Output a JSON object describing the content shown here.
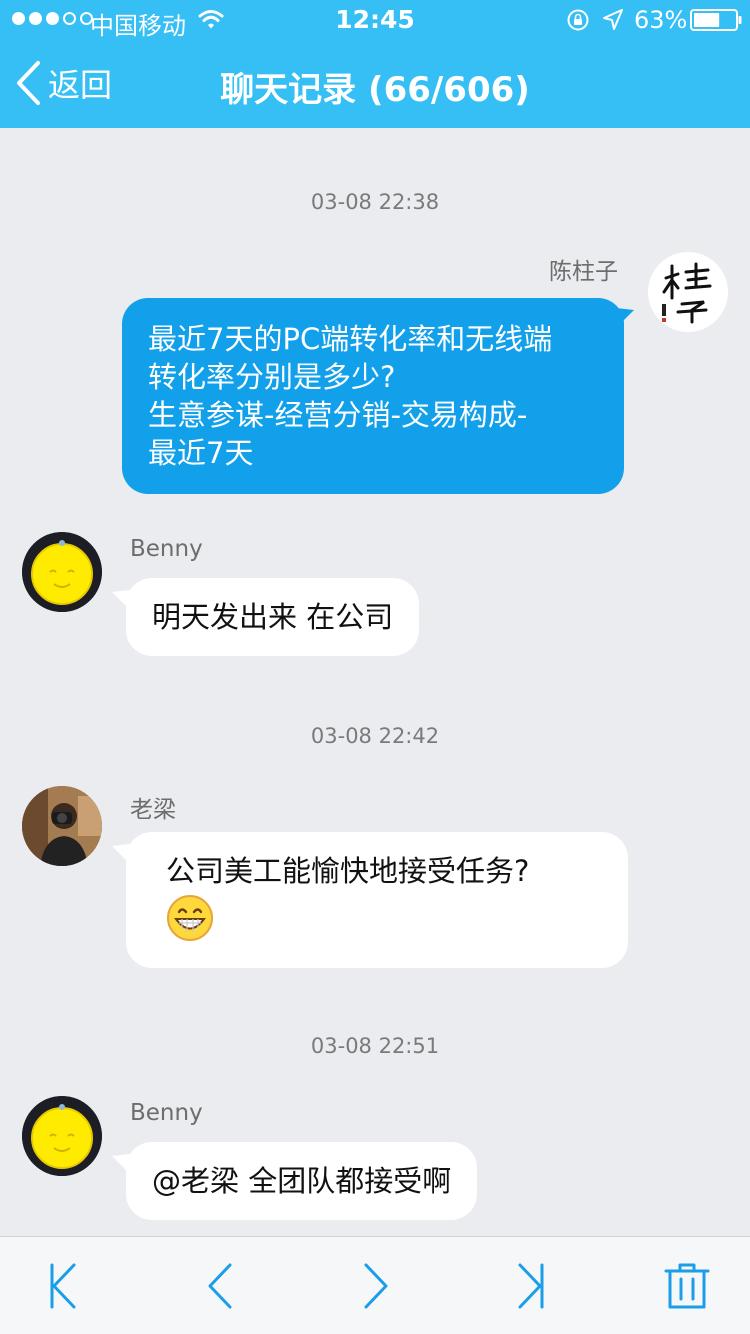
{
  "status_bar": {
    "carrier": "中国移动",
    "time": "12:45",
    "battery": "63%",
    "battery_level": 0.63,
    "signal_bars": 3,
    "icons": [
      "wifi-icon",
      "orientation-lock-icon",
      "location-arrow-icon",
      "battery-icon"
    ]
  },
  "nav": {
    "back_label": "返回",
    "title": "聊天记录 (66/606)",
    "accent_color": "#35bff5"
  },
  "messages": [
    {
      "timestamp": "03-08 22:38",
      "sender": "陈柱子",
      "direction": "outgoing",
      "lines": [
        "最近7天的PC端转化率和无线端",
        "转化率分别是多少?",
        "生意参谋-经营分销-交易构成-",
        "最近7天"
      ]
    },
    {
      "sender": "Benny",
      "direction": "incoming",
      "lines": [
        "明天发出来 在公司"
      ]
    },
    {
      "timestamp": "03-08 22:42",
      "sender": "老梁",
      "direction": "incoming",
      "lines": [
        "公司美工能愉快地接受任务?"
      ],
      "emoji": "grinning-face-icon"
    },
    {
      "timestamp": "03-08 22:51",
      "sender": "Benny",
      "direction": "incoming",
      "lines": [
        "@老梁 全团队都接受啊"
      ]
    }
  ],
  "toolbar": {
    "buttons": [
      "first-page-icon",
      "previous-page-icon",
      "next-page-icon",
      "last-page-icon",
      "trash-icon"
    ],
    "icon_color": "#1a9ee8"
  }
}
